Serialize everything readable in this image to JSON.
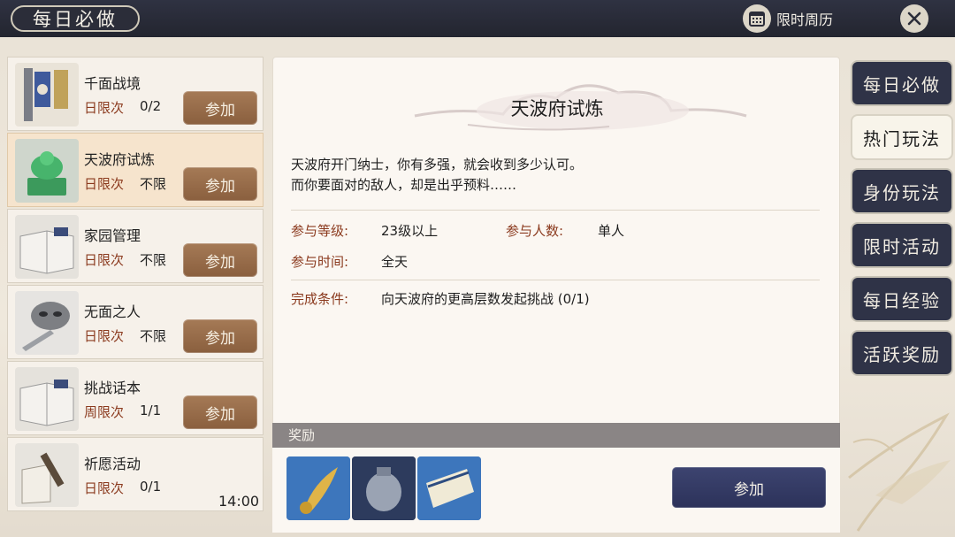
{
  "header": {
    "title": "每日必做",
    "calendar_label": "限时周历"
  },
  "activities": [
    {
      "name": "千面战境",
      "limit_label": "日限次",
      "limit_value": "0/2",
      "button": "参加"
    },
    {
      "name": "天波府试炼",
      "limit_label": "日限次",
      "limit_value": "不限",
      "button": "参加"
    },
    {
      "name": "家园管理",
      "limit_label": "日限次",
      "limit_value": "不限",
      "button": "参加"
    },
    {
      "name": "无面之人",
      "limit_label": "日限次",
      "limit_value": "不限",
      "button": "参加"
    },
    {
      "name": "挑战话本",
      "limit_label": "周限次",
      "limit_value": "1/1",
      "button": "参加"
    },
    {
      "name": "祈愿活动",
      "limit_label": "日限次",
      "limit_value": "0/1",
      "time": "14:00"
    }
  ],
  "detail": {
    "title": "天波府试炼",
    "desc_line1": "天波府开门纳士，你有多强，就会收到多少认可。",
    "desc_line2": "而你要面对的敌人，却是出乎预料……",
    "level_label": "参与等级:",
    "level_value": "23级以上",
    "players_label": "参与人数:",
    "players_value": "单人",
    "time_label": "参与时间:",
    "time_value": "全天",
    "condition_label": "完成条件:",
    "condition_value": "向天波府的更高层数发起挑战 (0/1)"
  },
  "reward": {
    "header": "奖励",
    "items": [
      "jade-key-icon",
      "silver-pouch-icon",
      "scroll-ticket-icon"
    ],
    "join_button": "参加"
  },
  "tabs": [
    {
      "label": "每日必做",
      "active": false
    },
    {
      "label": "热门玩法",
      "active": true
    },
    {
      "label": "身份玩法",
      "active": false
    },
    {
      "label": "限时活动",
      "active": false
    },
    {
      "label": "每日经验",
      "active": false
    },
    {
      "label": "活跃奖励",
      "active": false
    }
  ]
}
